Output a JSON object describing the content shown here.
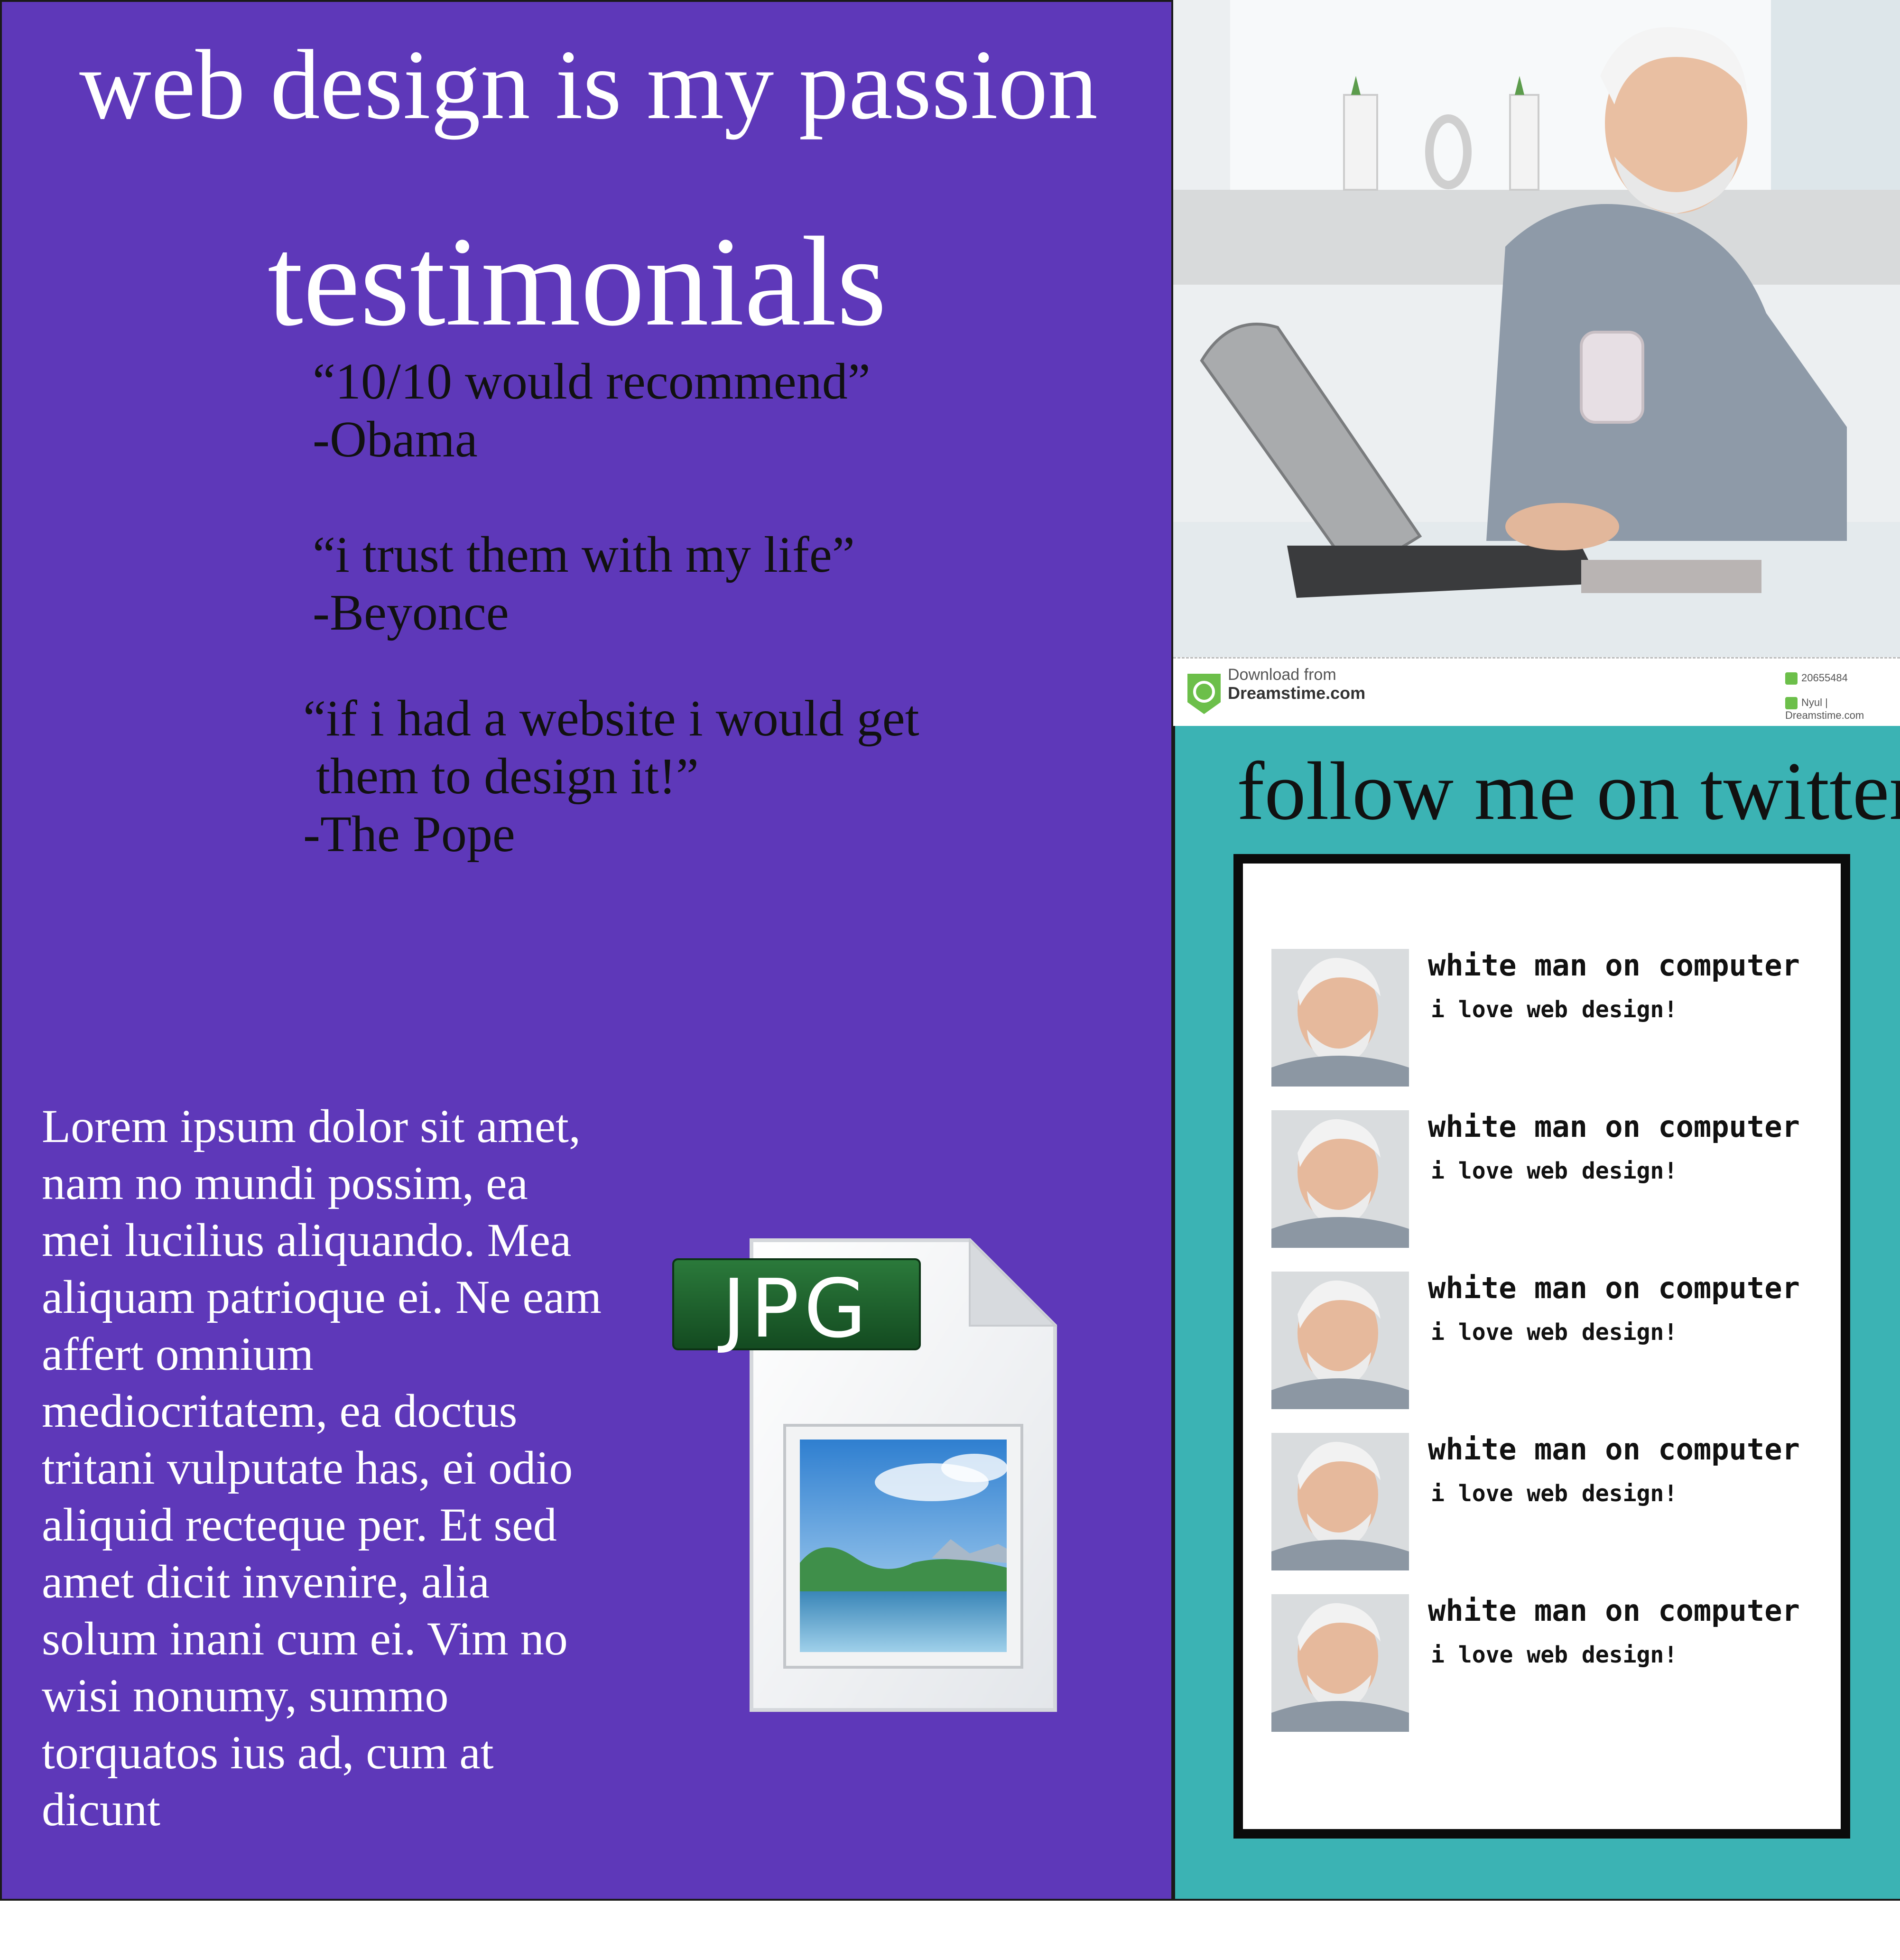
{
  "header": {
    "title": "web design is my passion"
  },
  "testimonials": {
    "heading": "testimonials",
    "items": [
      {
        "quote": "“10/10 would recommend”",
        "author": "-Obama"
      },
      {
        "quote": "“i trust them with my life”",
        "author": "-Beyonce"
      },
      {
        "quote_line1": "“if i had a website i would get",
        "quote_line2": " them to design it!”",
        "author": "-The Pope"
      }
    ]
  },
  "body_text": "Lorem ipsum dolor sit amet, nam no mundi possim, ea mei lucilius aliquando. Mea aliquam patrioque ei. Ne eam affert omnium mediocritatem, ea doctus tritani vulputate has, ei odio aliquid recteque per. Et sed amet dicit invenire, alia solum inani cum ei. Vim no wisi nonumy, summo torquatos ius ad, cum at dicunt",
  "file_icon": {
    "icon": "jpg-file-icon",
    "label": "JPG"
  },
  "stock_photo": {
    "watermark_line1": "Download from",
    "watermark_line2": "Dreamstime.com",
    "image_id": "20655484",
    "credit": "Nyul | Dreamstime.com"
  },
  "twitter": {
    "heading": "follow me on twitter",
    "tweets": [
      {
        "name": "white man on computer",
        "text": "i love web design!"
      },
      {
        "name": "white man on computer",
        "text": "i love web design!"
      },
      {
        "name": "white man on computer",
        "text": "i love web design!"
      },
      {
        "name": "white man on computer",
        "text": "i love web design!"
      },
      {
        "name": "white man on computer",
        "text": "i love web design!"
      }
    ]
  },
  "colors": {
    "left_panel": "#5e38b9",
    "twitter_panel": "#3bb3b4",
    "jpg_label": "#1f5e2e"
  }
}
